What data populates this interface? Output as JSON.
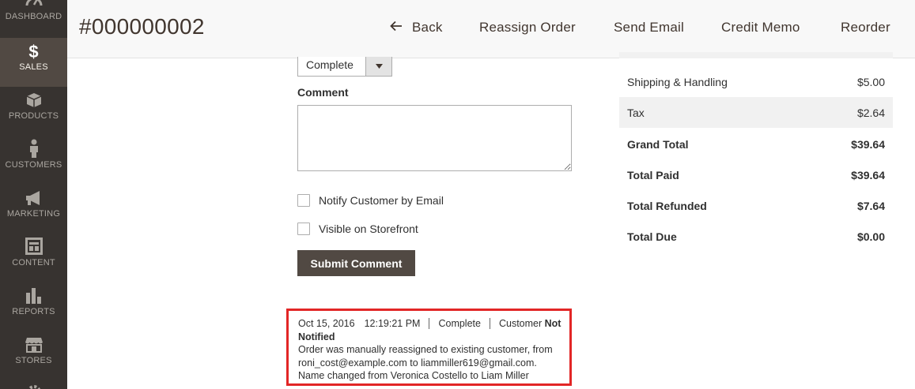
{
  "sidebar": {
    "items": [
      {
        "label": "Dashboard",
        "icon": "dashboard-icon"
      },
      {
        "label": "Sales",
        "icon": "dollar-icon",
        "active": true
      },
      {
        "label": "Products",
        "icon": "box-icon"
      },
      {
        "label": "Customers",
        "icon": "person-icon"
      },
      {
        "label": "Marketing",
        "icon": "megaphone-icon"
      },
      {
        "label": "Content",
        "icon": "layout-icon"
      },
      {
        "label": "Reports",
        "icon": "bar-chart-icon"
      },
      {
        "label": "Stores",
        "icon": "store-icon"
      }
    ]
  },
  "header": {
    "title": "#000000002",
    "buttons": {
      "back": "Back",
      "reassign": "Reassign Order",
      "send_email": "Send Email",
      "credit_memo": "Credit Memo",
      "reorder": "Reorder"
    }
  },
  "comment_form": {
    "status_value": "Complete",
    "comment_label": "Comment",
    "comment_value": "",
    "notify_label": "Notify Customer by Email",
    "visible_label": "Visible on Storefront",
    "submit_label": "Submit Comment"
  },
  "history": {
    "date": "Oct 15, 2016",
    "time": "12:19:21 PM",
    "status": "Complete",
    "customer_label": "Customer",
    "notified": "Not Notified",
    "message": "Order was manually reassigned to existing customer, from roni_cost@example.com to liammiller619@gmail.com. Name changed from Veronica Costello to Liam Miller"
  },
  "totals": {
    "rows": [
      {
        "label": "Shipping & Handling",
        "value": "$5.00"
      },
      {
        "label": "Tax",
        "value": "$2.64"
      },
      {
        "label": "Grand Total",
        "value": "$39.64"
      },
      {
        "label": "Total Paid",
        "value": "$39.64"
      },
      {
        "label": "Total Refunded",
        "value": "$7.64"
      },
      {
        "label": "Total Due",
        "value": "$0.00"
      }
    ]
  },
  "colors": {
    "sidebar_bg": "#373330",
    "sidebar_active": "#514943",
    "button_dark": "#514943",
    "highlight_border": "#e22626"
  }
}
